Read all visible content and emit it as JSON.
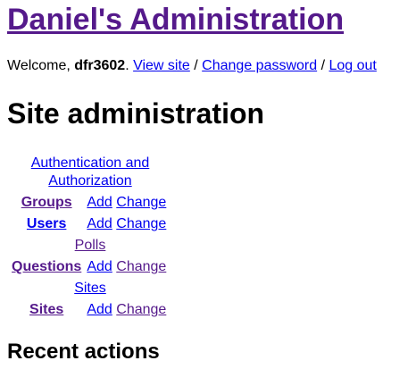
{
  "header": {
    "title": "Daniel's Administration"
  },
  "user_tools": {
    "welcome": "Welcome, ",
    "username": "dfr3602",
    "after_username": ". ",
    "view_site": "View site",
    "sep1": " / ",
    "change_password": "Change password",
    "sep2": " / ",
    "log_out": "Log out"
  },
  "content": {
    "title": "Site administration"
  },
  "apps": [
    {
      "name": "Authentication and Authorization",
      "models": [
        {
          "name": "Groups",
          "add": "Add",
          "change": "Change"
        },
        {
          "name": "Users",
          "add": "Add",
          "change": "Change"
        }
      ]
    },
    {
      "name": "Polls",
      "models": [
        {
          "name": "Questions",
          "add": "Add",
          "change": "Change"
        }
      ]
    },
    {
      "name": "Sites",
      "models": [
        {
          "name": "Sites",
          "add": "Add",
          "change": "Change"
        }
      ]
    }
  ],
  "sidebar": {
    "recent_actions_title": "Recent actions"
  },
  "colors": {
    "visited_link": "#551a8b",
    "link": "#0000ee",
    "text": "#000000",
    "background": "#ffffff"
  }
}
